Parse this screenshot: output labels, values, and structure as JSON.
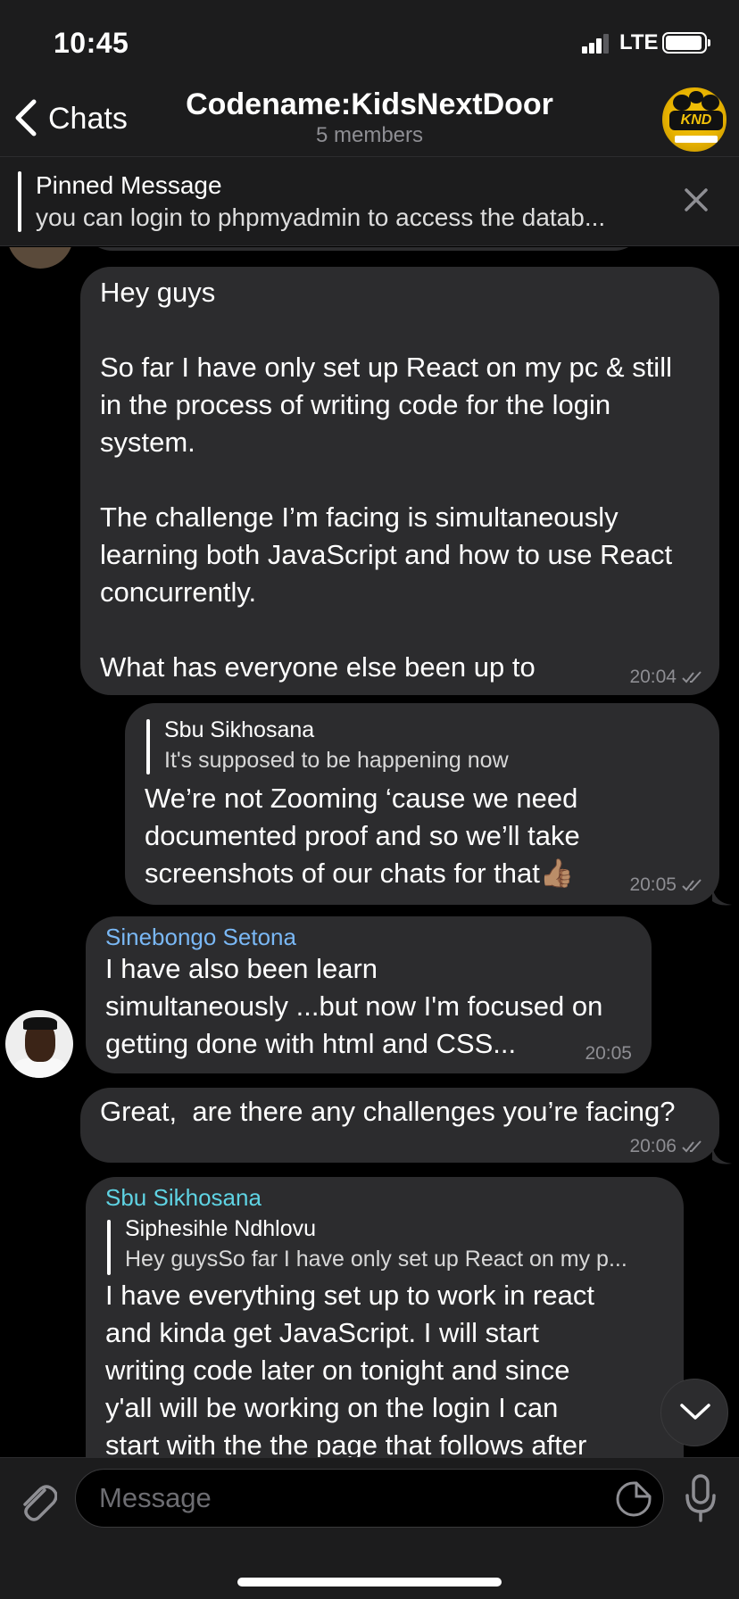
{
  "status_bar": {
    "time": "10:45",
    "network": "LTE"
  },
  "nav": {
    "back_label": "Chats",
    "title": "Codename:KidsNextDoor",
    "subtitle": "5 members",
    "avatar_logo": "KND"
  },
  "pinned": {
    "title": "Pinned Message",
    "text": "you can login to phpmyadmin to access the datab..."
  },
  "messages": [
    {
      "direction": "outgoing",
      "text": "Hey guys\n\nSo far I have only set up React on my pc & still\nin the process of writing code for the login\nsystem.\n\nThe challenge I’m facing is simultaneously\nlearning both JavaScript and how to use React\nconcurrently.\n\nWhat has everyone else been up to",
      "time": "20:04",
      "status": "read"
    },
    {
      "direction": "outgoing",
      "reply_to": {
        "name": "Sbu Sikhosana",
        "text": "It's supposed to be happening now"
      },
      "text": "We’re not Zooming ‘cause we need\ndocumented proof and so we’ll take\nscreenshots of our chats for that👍🏽",
      "time": "20:05",
      "status": "read"
    },
    {
      "direction": "incoming",
      "sender": "Sinebongo Setona",
      "sender_color": "#7ab8f5",
      "text": "I have also been learn\nsimultaneously ...but now I'm focused on\ngetting done with html and CSS...",
      "time": "20:05"
    },
    {
      "direction": "outgoing",
      "text": "Great,  are there any challenges you’re facing?",
      "time": "20:06",
      "status": "read"
    },
    {
      "direction": "incoming",
      "sender": "Sbu Sikhosana",
      "sender_color": "#5fd3e3",
      "reply_to": {
        "name": "Siphesihle Ndhlovu",
        "text": "Hey guysSo far I have only set up React on my p..."
      },
      "text": "I have everything set up to work in react\nand kinda get JavaScript. I will start\nwriting code later on tonight and since\ny'all will be working on the login I can\nstart with the the page that follows after"
    }
  ],
  "input": {
    "placeholder": "Message"
  },
  "icons": {
    "back": "chevron-left-icon",
    "close": "close-icon",
    "scroll": "chevron-down-icon",
    "attach": "paperclip-icon",
    "sticker": "sticker-icon",
    "mic": "microphone-icon"
  },
  "colors": {
    "background": "#000000",
    "bubble": "#2c2c2e",
    "bar": "#1c1c1d",
    "muted": "#8e8e93"
  }
}
